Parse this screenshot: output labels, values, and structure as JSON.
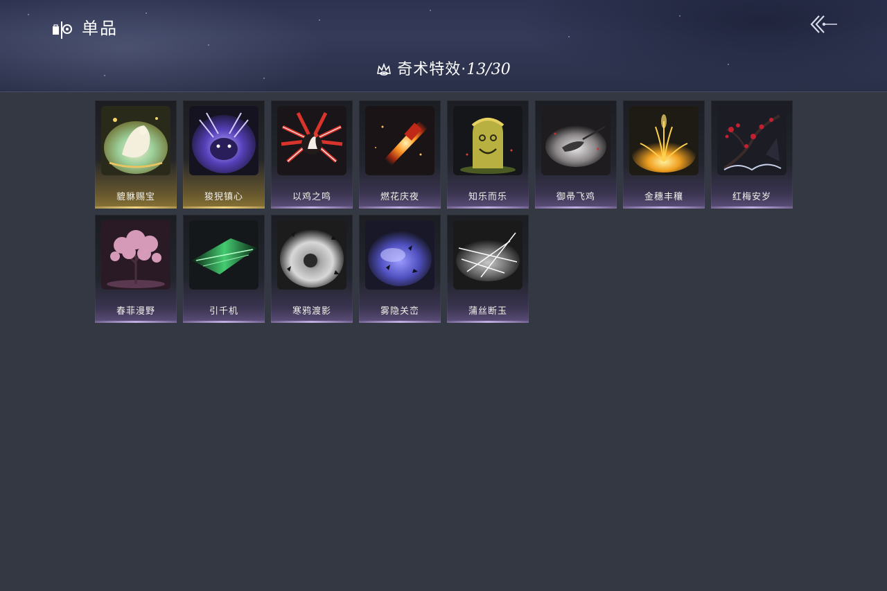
{
  "header": {
    "section_title": "单品",
    "section_icon": "collection-icon",
    "back_icon": "back-arrow-icon"
  },
  "subtitle": {
    "icon": "crown-icon",
    "label": "奇术特效·",
    "count": "13/30"
  },
  "items": [
    {
      "name": "貔貅赐宝",
      "rarity": "gold",
      "art": "gold-beast-art"
    },
    {
      "name": "狻猊镇心",
      "rarity": "gold",
      "art": "purple-lion-art"
    },
    {
      "name": "以鸡之鸣",
      "rarity": "purple",
      "art": "rooster-firecracker-art"
    },
    {
      "name": "燃花庆夜",
      "rarity": "purple",
      "art": "fireworks-art"
    },
    {
      "name": "知乐而乐",
      "rarity": "purple",
      "art": "smiling-stone-art"
    },
    {
      "name": "御帚飞鸡",
      "rarity": "purple",
      "art": "flying-broom-art"
    },
    {
      "name": "金穗丰穰",
      "rarity": "purple",
      "art": "golden-wheat-art"
    },
    {
      "name": "红梅安岁",
      "rarity": "purple",
      "art": "red-plum-art"
    },
    {
      "name": "春菲漫野",
      "rarity": "purple",
      "art": "pink-blossom-tree-art"
    },
    {
      "name": "引千机",
      "rarity": "purple",
      "art": "green-blade-art"
    },
    {
      "name": "寒鸦渡影",
      "rarity": "purple",
      "art": "crow-shadow-art"
    },
    {
      "name": "雾隐关峦",
      "rarity": "purple",
      "art": "purple-mist-art"
    },
    {
      "name": "蒲丝断玉",
      "rarity": "purple",
      "art": "silk-slash-art"
    }
  ]
}
